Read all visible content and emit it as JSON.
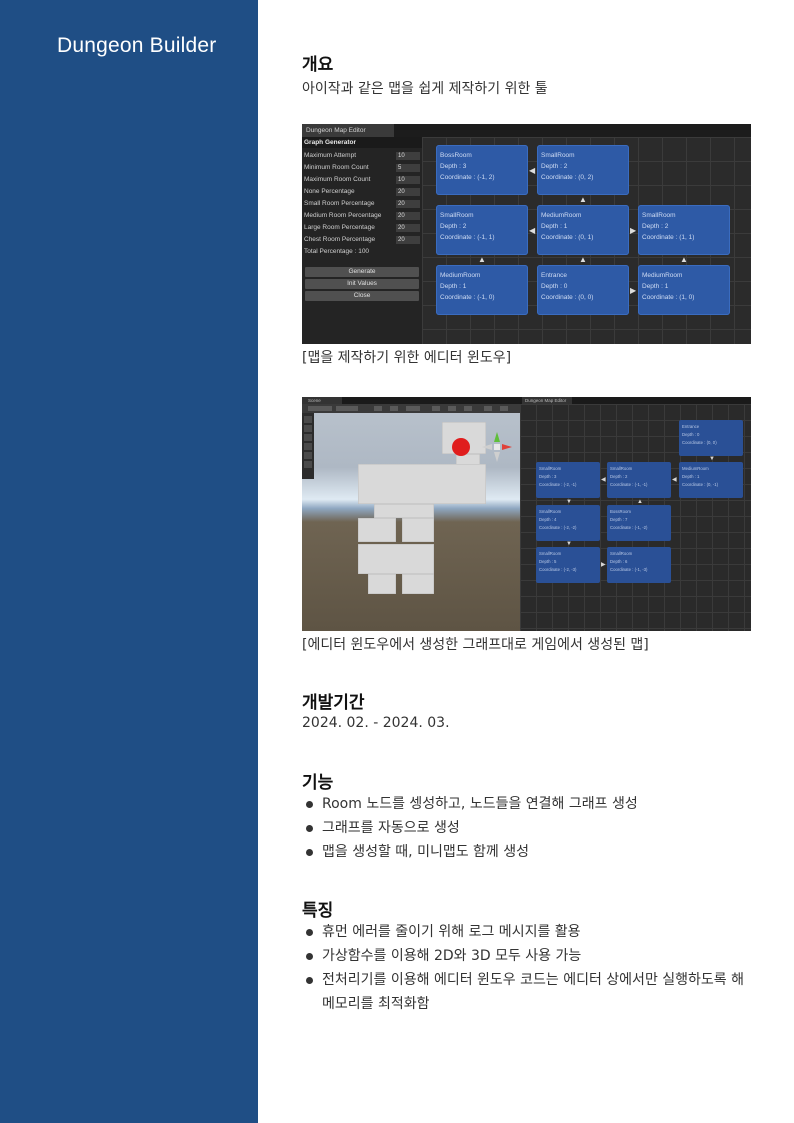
{
  "sidebar": {
    "title": "Dungeon Builder"
  },
  "overview": {
    "heading": "개요",
    "text": "아이작과 같은 맵을 쉽게 제작하기 위한 툴",
    "caption1": "[맵을 제작하기 위한 에디터 윈도우]",
    "caption2": "[에디터 윈도우에서 생성한 그래프대로 게임에서 생성된 맵]"
  },
  "editor1": {
    "tab": "Dungeon Map Editor",
    "panel_title": "Graph Generator",
    "params": [
      {
        "label": "Maximum Attempt",
        "value": "10"
      },
      {
        "label": "Minimum Room Count",
        "value": "5"
      },
      {
        "label": "Maximum Room Count",
        "value": "10"
      },
      {
        "label": "None Percentage",
        "value": "20"
      },
      {
        "label": "Small Room Percentage",
        "value": "20"
      },
      {
        "label": "Medium Room Percentage",
        "value": "20"
      },
      {
        "label": "Large Room Percentage",
        "value": "20"
      },
      {
        "label": "Chest Room Percentage",
        "value": "20"
      }
    ],
    "total": "Total Percentage : 100",
    "buttons": [
      "Generate",
      "Init Values",
      "Close"
    ],
    "nodes": [
      {
        "title": "BossRoom",
        "depth": "Depth : 3",
        "coord": "Coordinate : (-1, 2)"
      },
      {
        "title": "SmallRoom",
        "depth": "Depth : 2",
        "coord": "Coordinate : (0, 2)"
      },
      {
        "title": "SmallRoom",
        "depth": "Depth : 2",
        "coord": "Coordinate : (-1, 1)"
      },
      {
        "title": "MediumRoom",
        "depth": "Depth : 1",
        "coord": "Coordinate : (0, 1)"
      },
      {
        "title": "SmallRoom",
        "depth": "Depth : 2",
        "coord": "Coordinate : (1, 1)"
      },
      {
        "title": "MediumRoom",
        "depth": "Depth : 1",
        "coord": "Coordinate : (-1, 0)"
      },
      {
        "title": "Entrance",
        "depth": "Depth : 0",
        "coord": "Coordinate : (0, 0)"
      },
      {
        "title": "MediumRoom",
        "depth": "Depth : 1",
        "coord": "Coordinate : (1, 0)"
      }
    ]
  },
  "editor2": {
    "scene_tab": "Scene",
    "map_tab": "Dungeon Map Editor",
    "nodes": [
      {
        "title": "Entrance",
        "depth": "Depth : 0",
        "coord": "Coordinate : (0, 0)"
      },
      {
        "title": "SmallRoom",
        "depth": "Depth : 3",
        "coord": "Coordinate : (-2, -1)"
      },
      {
        "title": "SmallRoom",
        "depth": "Depth : 2",
        "coord": "Coordinate : (-1, -1)"
      },
      {
        "title": "MediumRoom",
        "depth": "Depth : 1",
        "coord": "Coordinate : (0, -1)"
      },
      {
        "title": "SmallRoom",
        "depth": "Depth : 4",
        "coord": "Coordinate : (-2, -2)"
      },
      {
        "title": "BossRoom",
        "depth": "Depth : 7",
        "coord": "Coordinate : (-1, -2)"
      },
      {
        "title": "SmallRoom",
        "depth": "Depth : 5",
        "coord": "Coordinate : (-2, -3)"
      },
      {
        "title": "SmallRoom",
        "depth": "Depth : 6",
        "coord": "Coordinate : (-1, -3)"
      }
    ]
  },
  "period": {
    "heading": "개발기간",
    "text": "2024. 02. - 2024. 03."
  },
  "features": {
    "heading": "기능",
    "items": [
      "Room 노드를 셍성하고, 노드들을 연결해 그래프 생성",
      "그래프를 자동으로 생성",
      "맵을 생성할 때, 미니맵도 함께 생성"
    ]
  },
  "traits": {
    "heading": "특징",
    "items": [
      "휴먼 에러를 줄이기 위해 로그 메시지를 활용",
      "가상함수를 이용해 2D와 3D 모두 사용 가능",
      "전처리기를 이용해 에디터 윈도우 코드는 에디터 상에서만 실행하도록 해  메모리를 최적화함"
    ]
  }
}
